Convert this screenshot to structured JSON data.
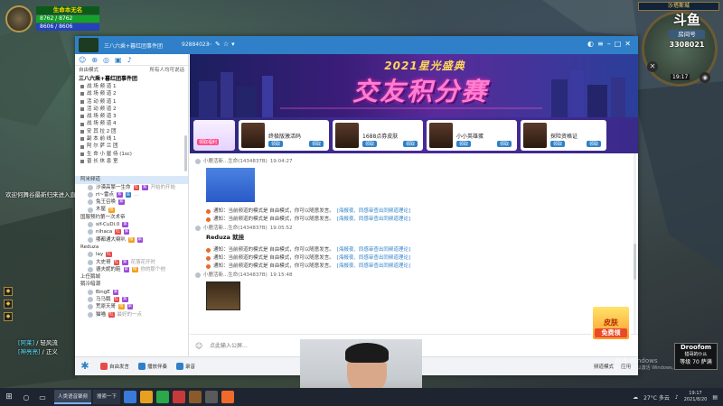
{
  "game": {
    "player_name": "生命本无名",
    "hp": "8762 / 8762",
    "mp": "8606 / 8606",
    "zone": "沙塔斯城",
    "map_time": "19:17",
    "welcome": "欢迎何舞谷最新归来进入直播间",
    "guild_lines": [
      {
        "name": "[阿莱]",
        "text": "/ 轻风流"
      },
      {
        "name": "[神亮亮]",
        "text": "/ 正义"
      }
    ]
  },
  "stream": {
    "logo": "斗鱼",
    "room_label": "房间号",
    "room_number": "3308021",
    "skin_badge_top": "皮肤",
    "skin_badge_bottom": "免费领",
    "windows_watermark": [
      "激活 Windows",
      "转到\"设置\"以激活 Windows。"
    ],
    "streamer_name": "Droofom",
    "streamer_sub": "猎哥的仆从",
    "streamer_level": "等级 70 萨满"
  },
  "app": {
    "title": "三八六乘+暮红团事件团",
    "title_id": "92884023",
    "sidebar": {
      "mode": "自由模式",
      "mode_right": "所有人均可说话",
      "channel": "三八六乘+暮红团事件团",
      "subchannels": [
        "战 场 频 道 1",
        "战 场 频 道 2",
        "活 动 频 道 1",
        "活 动 频 道 2",
        "战 场 频 道 3",
        "战 场 频 道 4",
        "安 其 拉 2 团",
        "副 本 前 线 1",
        "阿 尔 萨 兰 团",
        "生 命 小 屋 侍 (1sc)",
        "普 长 休 息 室"
      ],
      "section1": "阿米频道",
      "section1_users": [
        {
          "name": "沙漠高擎一生命",
          "badges": [
            "红",
            "紫"
          ],
          "note": "开始的开始"
        },
        {
          "name": "rt~雷点",
          "badges": [
            "紫",
            "蓝"
          ],
          "note": "..."
        },
        {
          "name": "兔王召唤",
          "badges": [
            "紫"
          ],
          "note": ""
        },
        {
          "name": "木屋",
          "badges": [
            "橙"
          ],
          "note": ""
        }
      ],
      "section2": "国服预约第一次术帝",
      "section2_users": [
        {
          "name": "sif-CuDi.0",
          "badges": [
            "紫"
          ],
          "note": ""
        },
        {
          "name": "nihaca",
          "badges": [
            "红",
            "紫"
          ],
          "note": ""
        },
        {
          "name": "哪都通大喇叭",
          "badges": [
            "橙",
            "紫"
          ],
          "note": ""
        }
      ],
      "section3": "Reduza",
      "section3_users": [
        {
          "name": "lay",
          "badges": [
            "红"
          ],
          "note": ""
        },
        {
          "name": "大史哥",
          "badges": [
            "红",
            "紫"
          ],
          "note": "花落花开时"
        },
        {
          "name": "德夫妮的鞋",
          "badges": [
            "紫",
            "橙"
          ],
          "note": "你的那个他"
        }
      ],
      "section4": "上任鹅城",
      "section5": "鹅冷暗潮",
      "section5_users": [
        {
          "name": "BingE",
          "badges": [
            "紫"
          ],
          "note": ""
        },
        {
          "name": "马马鹅",
          "badges": [
            "红",
            "紫"
          ],
          "note": ""
        },
        {
          "name": "荒原天哥",
          "badges": [
            "橙",
            "紫"
          ],
          "note": ""
        },
        {
          "name": "猫喵",
          "badges": [
            "红"
          ],
          "note": "最好的一点"
        }
      ]
    },
    "banner": {
      "year": "2021星光盛典",
      "title": "交友积分赛"
    },
    "promo": {
      "first_label": "领取福利",
      "cards": [
        {
          "title": "终极版激活码",
          "btn1": "领取",
          "btn2": "领取"
        },
        {
          "title": "1688点券皮肤",
          "btn1": "领取",
          "btn2": "领取"
        },
        {
          "title": "小小英雄蛋",
          "btn1": "领取",
          "btn2": "领取"
        },
        {
          "title": "探险资格证",
          "btn1": "领取",
          "btn2": "领取"
        }
      ]
    },
    "chat": {
      "user": "小鹿活新...生命(1434837B)",
      "time1": "19:04:27",
      "notice_text": "通知：当前频道的模式是 自由模式，你可以随意发言。",
      "notice_links": "[海报夜、同感审查出同频道理论]",
      "time2": "19:05:52",
      "text_msg": "Reduza 就挂",
      "time3": "19:15:48"
    },
    "input_placeholder": "点此输入公屏...",
    "bottombar": {
      "item1": "自由发言",
      "item2": "播放伴奏",
      "item3": "录音",
      "right1": "频道模式",
      "right2": "应用"
    }
  },
  "taskbar": {
    "app1": "人类语音聚频",
    "app2": "搜索一下",
    "temperature": "27°C 多云",
    "time": "19:17",
    "date": "2021/8/20"
  },
  "colors": {
    "accent": "#2f80c8",
    "banner_title": "#ff7fd0",
    "gold": "#ffd200"
  }
}
